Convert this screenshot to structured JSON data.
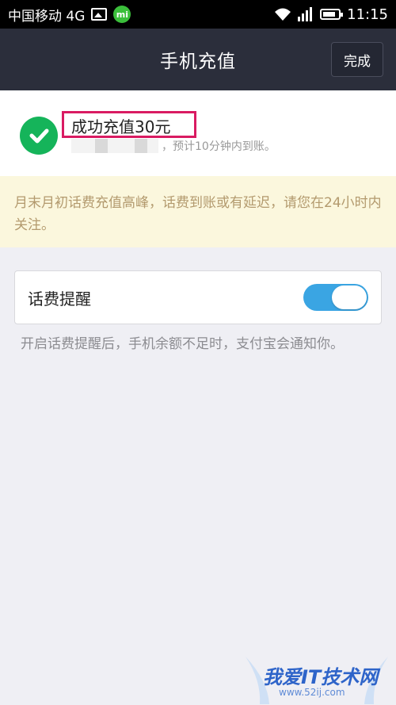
{
  "status_bar": {
    "carrier": "中国移动 4G",
    "time": "11:15",
    "icons": [
      "image-icon",
      "mi-app-icon",
      "wifi-icon",
      "signal-icon",
      "battery-icon"
    ]
  },
  "nav": {
    "title": "手机充值",
    "done_label": "完成"
  },
  "success": {
    "title": "成功充值30元",
    "subtitle": "，预计10分钟内到账。",
    "icon": "check-circle-icon",
    "highlight_color": "#d91b62",
    "check_color": "#15b45a"
  },
  "notice": {
    "text": "月末月初话费充值高峰，话费到账或有延迟，请您在24小时内关注。"
  },
  "reminder": {
    "label": "话费提醒",
    "toggle_on": true,
    "toggle_color": "#3aa5e3",
    "description": "开启话费提醒后，手机余额不足时，支付宝会通知你。"
  },
  "watermark": {
    "text": "我爱IT技术网",
    "url": "www.52ij.com"
  }
}
